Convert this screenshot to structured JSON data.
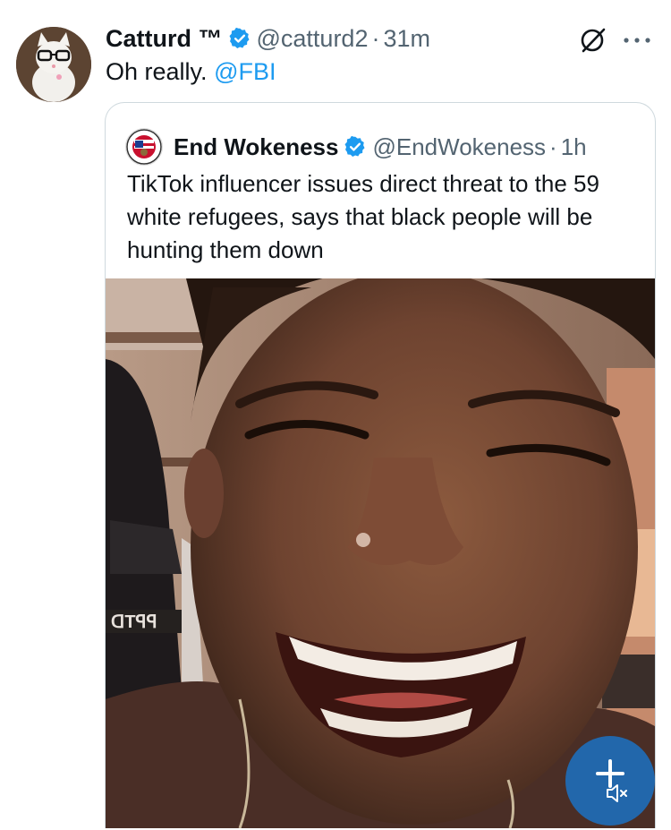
{
  "tweet": {
    "author_name": "Catturd ™",
    "handle": "@catturd2",
    "separator": "·",
    "time": "31m",
    "text_before": "Oh really.",
    "mention": "@FBI"
  },
  "quoted_tweet": {
    "author_name": "End Wokeness",
    "handle": "@EndWokeness",
    "separator": "·",
    "time": "1h",
    "text": "TikTok influencer issues direct threat to the 59 white refugees, says that black people will be hunting them down"
  },
  "media": {
    "overlay_text": "ᗡTꟼꟼ"
  },
  "colors": {
    "accent": "#1d9bf0",
    "secondary_text": "#536471",
    "border": "#cfd9de",
    "fab": "#1d6fbe"
  },
  "icons": {
    "verified": "verified-badge-icon",
    "grok": "grok-icon",
    "more": "more-icon",
    "compose": "compose-plus-icon",
    "mute": "volume-muted-icon"
  }
}
